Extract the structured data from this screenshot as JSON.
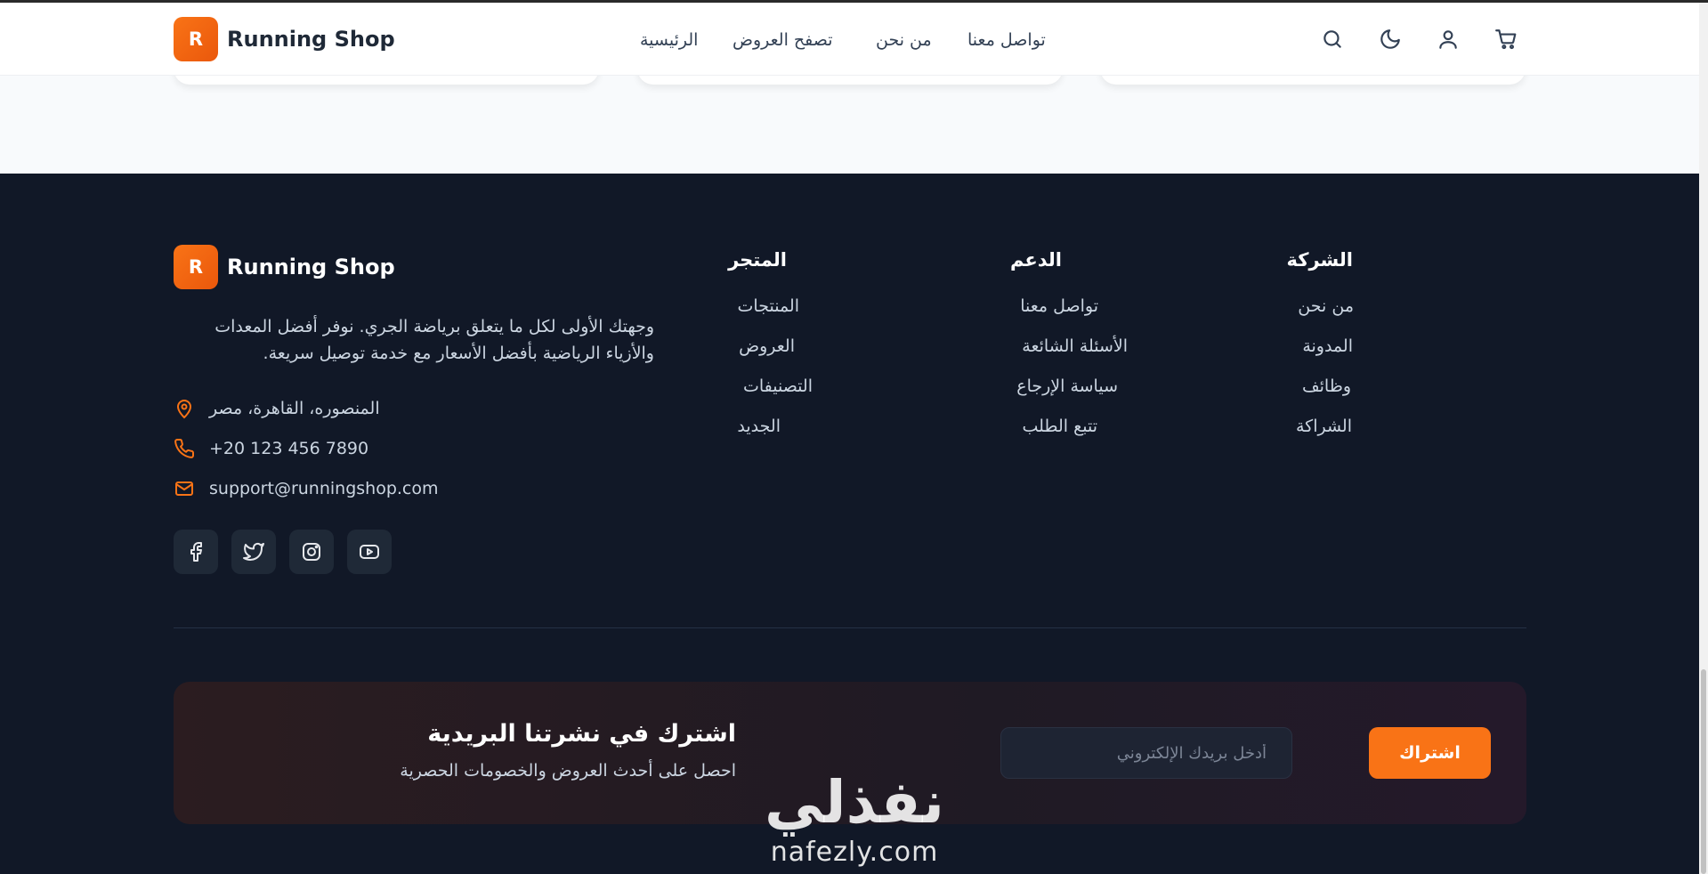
{
  "header": {
    "logo_letter": "R",
    "brand": "Running Shop",
    "nav": [
      "الرئيسية",
      "تصفح العروض",
      "من نحن",
      "تواصل معنا"
    ],
    "icons": [
      "search-icon",
      "moon-icon",
      "user-icon",
      "cart-icon"
    ]
  },
  "footer": {
    "logo_letter": "R",
    "brand": "Running Shop",
    "about": "وجهتك الأولى لكل ما يتعلق برياضة الجري. نوفر أفضل المعدات والأزياء الرياضية بأفضل الأسعار مع خدمة توصيل سريعة.",
    "contact": {
      "address": "المنصوره، القاهرة، مصر",
      "phone": "+20 123 456 7890",
      "email": "support@runningshop.com"
    },
    "social": [
      "facebook-icon",
      "twitter-icon",
      "instagram-icon",
      "youtube-icon"
    ],
    "columns": [
      {
        "title": "المتجر",
        "links": [
          "المنتجات",
          "العروض",
          "التصنيفات",
          "الجديد"
        ]
      },
      {
        "title": "الدعم",
        "links": [
          "تواصل معنا",
          "الأسئلة الشائعة",
          "سياسة الإرجاع",
          "تتبع الطلب"
        ]
      },
      {
        "title": "الشركة",
        "links": [
          "من نحن",
          "المدونة",
          "وظائف",
          "الشراكة"
        ]
      }
    ]
  },
  "newsletter": {
    "title": "اشترك في نشرتنا البريدية",
    "subtitle": "احصل على أحدث العروض والخصومات الحصرية",
    "placeholder": "أدخل بريدك الإلكتروني",
    "button": "اشتراك"
  },
  "watermark": {
    "arabic": "نفذلي",
    "latin": "nafezly.com"
  },
  "colors": {
    "accent": "#f97316",
    "footer_bg": "#111827",
    "page_bg": "#f8fafc"
  }
}
